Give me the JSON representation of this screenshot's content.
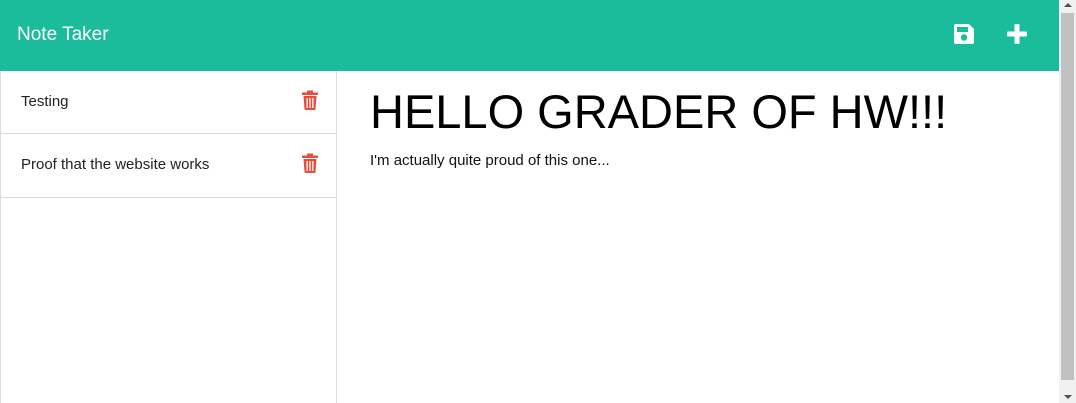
{
  "app": {
    "brand": "Note Taker"
  },
  "toolbar": {
    "save_icon": "floppy-disk-icon",
    "new_icon": "plus-icon"
  },
  "sidebar": {
    "items": [
      {
        "label": "Testing",
        "delete_icon": "trash-icon"
      },
      {
        "label": "Proof that the website works",
        "delete_icon": "trash-icon"
      }
    ]
  },
  "note": {
    "title": "HELLO GRADER OF HW!!!",
    "body": "I'm actually quite proud of this one..."
  },
  "colors": {
    "navbar": "#1abc9c",
    "delete": "#e74c3c",
    "text": "#000000"
  }
}
